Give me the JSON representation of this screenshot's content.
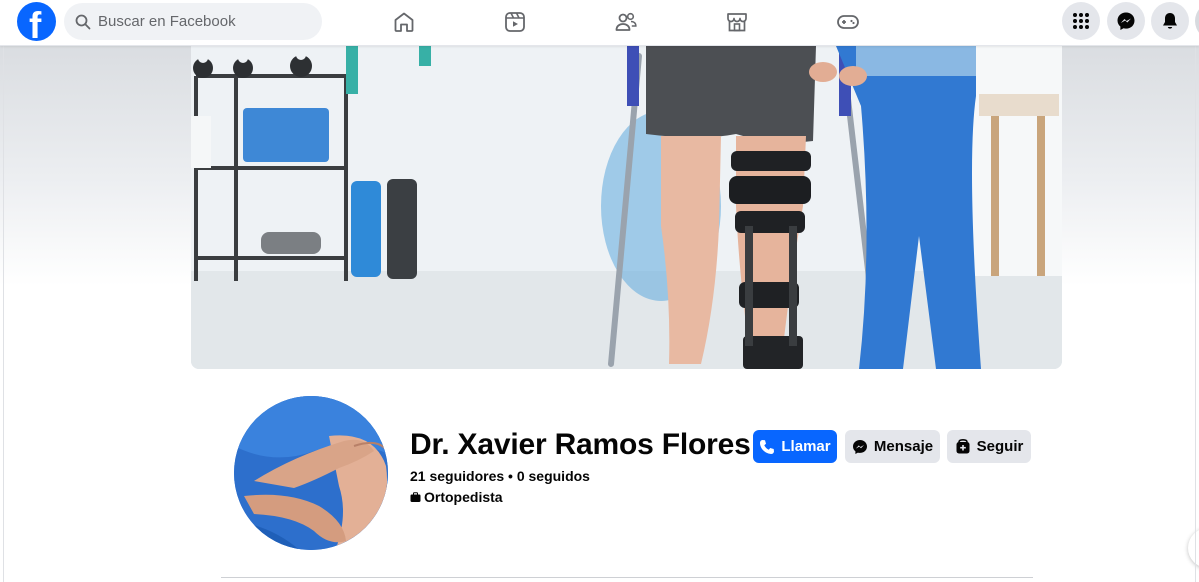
{
  "topbar": {
    "search": {
      "placeholder": "Buscar en Facebook"
    },
    "logo_icon": "facebook-logo-icon",
    "nav_icons": [
      "home-icon",
      "reels-icon",
      "friends-icon",
      "marketplace-icon",
      "gaming-icon"
    ],
    "right_icons": [
      "menu-grid-icon",
      "messenger-icon",
      "notifications-bell-icon"
    ]
  },
  "profile": {
    "name": "Dr. Xavier Ramos Flores",
    "stats": "21 seguidores • 0 seguidos",
    "category": "Ortopedista",
    "category_icon": "briefcase-icon"
  },
  "actions": {
    "call_label": "Llamar",
    "call_icon": "phone-icon",
    "message_label": "Mensaje",
    "message_icon": "messenger-icon",
    "follow_label": "Seguir",
    "follow_icon": "follow-icon"
  },
  "colors": {
    "accent": "#0866ff",
    "secondary_button": "#e4e6eb",
    "text": "#050505"
  }
}
